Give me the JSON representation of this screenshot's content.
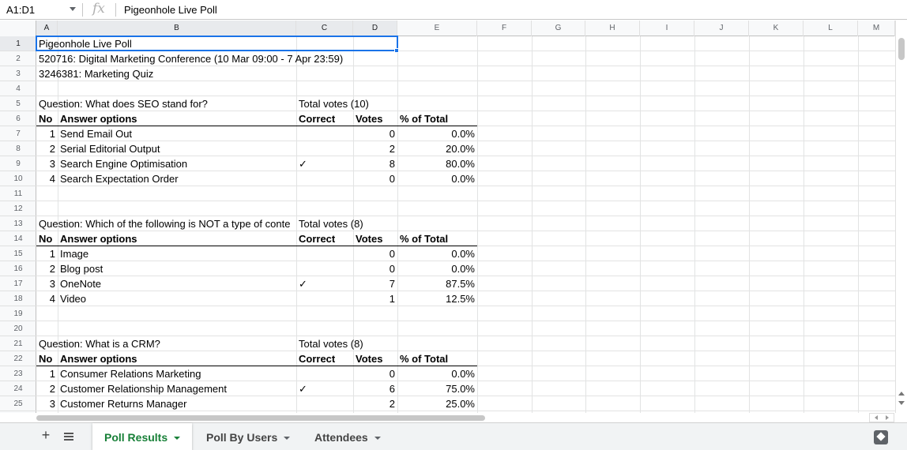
{
  "formula_bar": {
    "name_box": "A1:D1",
    "fx_icon": "fx",
    "value": "Pigeonhole Live Poll"
  },
  "columns": [
    "A",
    "B",
    "C",
    "D",
    "E",
    "F",
    "G",
    "H",
    "I",
    "J",
    "K",
    "L",
    "M"
  ],
  "rows": [
    "1",
    "2",
    "3",
    "4",
    "5",
    "6",
    "7",
    "8",
    "9",
    "10",
    "11",
    "12",
    "13",
    "14",
    "15",
    "16",
    "17",
    "18",
    "19",
    "20",
    "21",
    "22",
    "23",
    "24",
    "25"
  ],
  "sheet": {
    "title": "Pigeonhole Live Poll",
    "event": "520716: Digital Marketing Conference (10 Mar 09:00 - 7 Apr 23:59)",
    "poll": "3246381: Marketing Quiz",
    "headers": {
      "no": "No",
      "answer_options": "Answer options",
      "correct": "Correct",
      "votes": "Votes",
      "pct": "% of Total"
    },
    "questions": [
      {
        "question": "Question: What does SEO stand for?",
        "total": "Total votes (10)",
        "answers": [
          {
            "no": "1",
            "text": "Send Email Out",
            "correct": "",
            "votes": "0",
            "pct": "0.0%"
          },
          {
            "no": "2",
            "text": "Serial Editorial Output",
            "correct": "",
            "votes": "2",
            "pct": "20.0%"
          },
          {
            "no": "3",
            "text": "Search Engine Optimisation",
            "correct": "✓",
            "votes": "8",
            "pct": "80.0%"
          },
          {
            "no": "4",
            "text": "Search Expectation Order",
            "correct": "",
            "votes": "0",
            "pct": "0.0%"
          }
        ]
      },
      {
        "question": "Question: Which of the following is NOT a type of conte",
        "total": "Total votes (8)",
        "answers": [
          {
            "no": "1",
            "text": "Image",
            "correct": "",
            "votes": "0",
            "pct": "0.0%"
          },
          {
            "no": "2",
            "text": "Blog post",
            "correct": "",
            "votes": "0",
            "pct": "0.0%"
          },
          {
            "no": "3",
            "text": "OneNote",
            "correct": "✓",
            "votes": "7",
            "pct": "87.5%"
          },
          {
            "no": "4",
            "text": "Video",
            "correct": "",
            "votes": "1",
            "pct": "12.5%"
          }
        ]
      },
      {
        "question": "Question: What is a CRM?",
        "total": "Total votes (8)",
        "answers": [
          {
            "no": "1",
            "text": "Consumer Relations Marketing",
            "correct": "",
            "votes": "0",
            "pct": "0.0%"
          },
          {
            "no": "2",
            "text": "Customer Relationship Management",
            "correct": "✓",
            "votes": "6",
            "pct": "75.0%"
          },
          {
            "no": "3",
            "text": "Customer Returns Manager",
            "correct": "",
            "votes": "2",
            "pct": "25.0%"
          }
        ]
      }
    ]
  },
  "tabs": [
    {
      "label": "Poll Results",
      "active": true
    },
    {
      "label": "Poll By Users",
      "active": false
    },
    {
      "label": "Attendees",
      "active": false
    }
  ],
  "icons": {
    "add_sheet": "+",
    "active_tab_color": "#188038",
    "selection_color": "#1a73e8"
  }
}
